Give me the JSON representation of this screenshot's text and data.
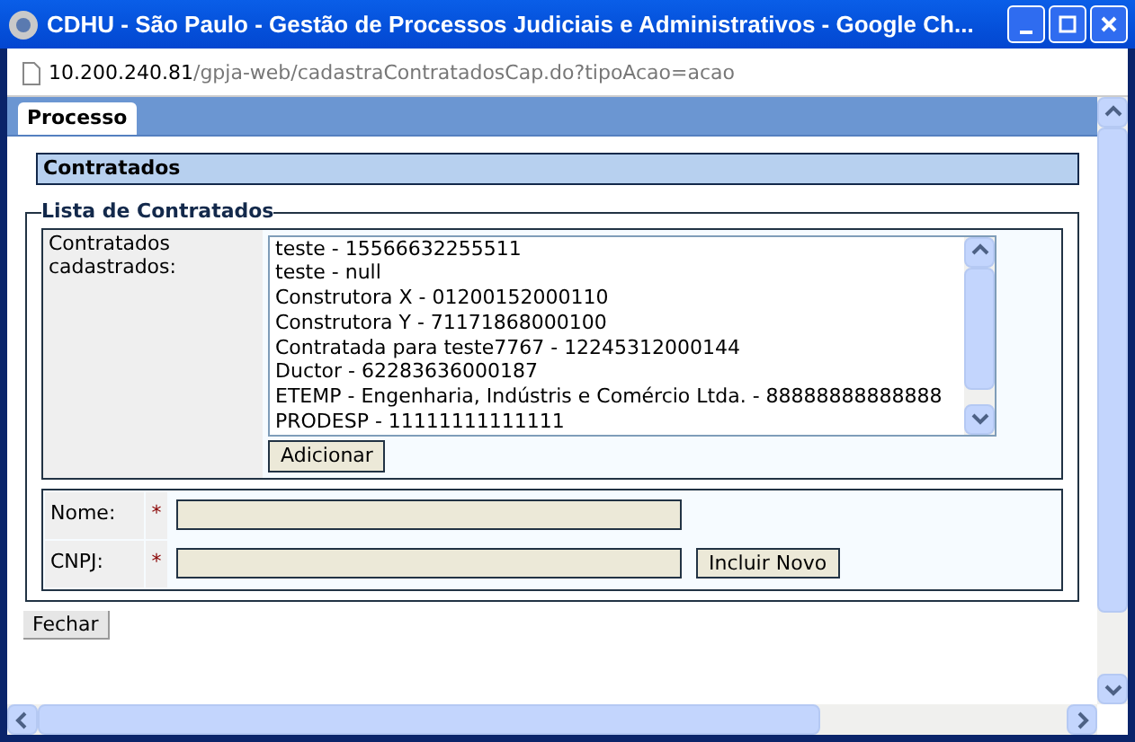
{
  "window": {
    "title": "CDHU - São Paulo - Gestão de Processos Judiciais e Administrativos - Google Ch..."
  },
  "address": {
    "host": "10.200.240.81",
    "path": "/gpja-web/cadastraContratadosCap.do?tipoAcao=acao"
  },
  "tabs": [
    {
      "label": "Processo",
      "selected": true
    }
  ],
  "section_title": "Contratados",
  "fieldset_legend": "Lista de Contratados",
  "list_label": "Contratados cadastrados:",
  "list_items": [
    "teste - 15566632255511",
    "teste - null",
    "Construtora X - 01200152000110",
    "Construtora Y - 71171868000100",
    "Contratada para teste7767 - 12245312000144",
    "Ductor - 62283636000187",
    "ETEMP - Engenharia, Indústris e Comércio Ltda. - 88888888888888",
    "PRODESP - 11111111111111"
  ],
  "add_button": "Adicionar",
  "form_fields": [
    {
      "label": "Nome:",
      "required_mark": "*"
    },
    {
      "label": "CNPJ:",
      "required_mark": "*",
      "button": "Incluir Novo"
    }
  ],
  "close_button": "Fechar"
}
